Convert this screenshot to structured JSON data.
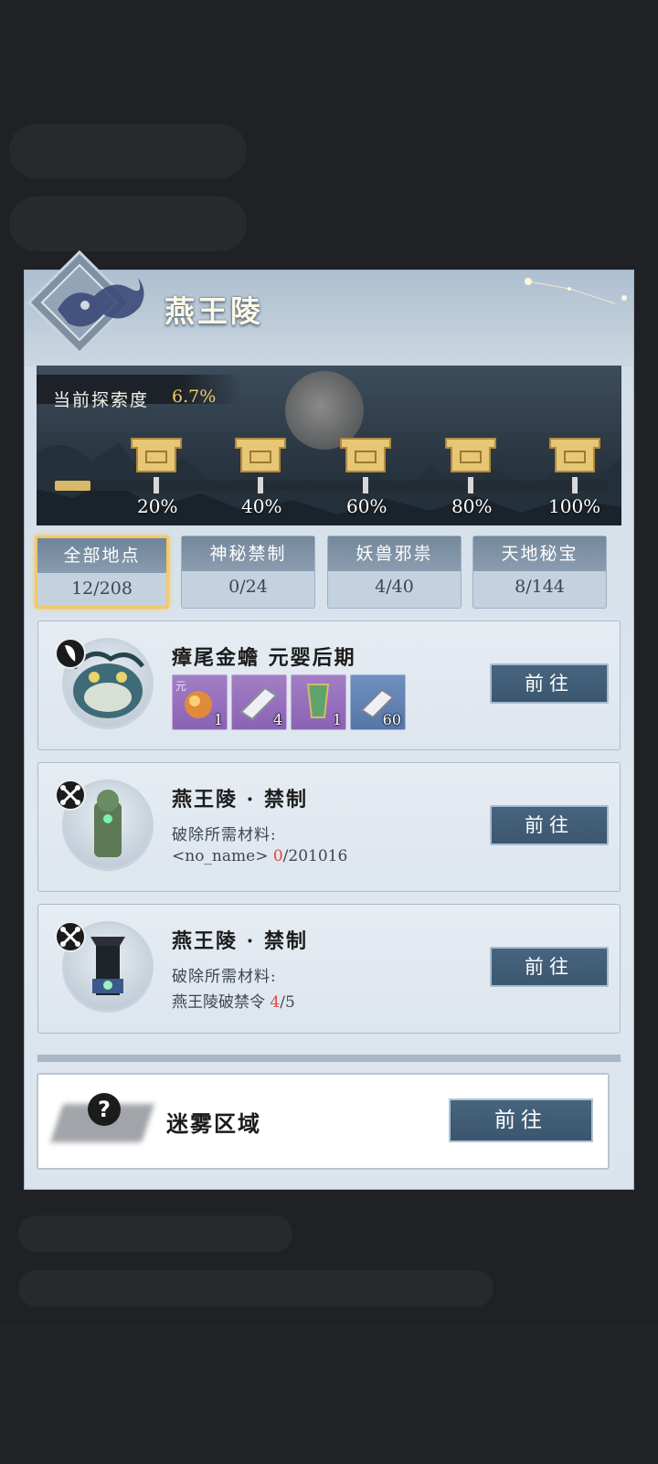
{
  "header": {
    "title": "燕王陵"
  },
  "progress": {
    "label": "当前探索度",
    "value": "6.7%",
    "fill_fraction": 0.067,
    "milestones": [
      "20%",
      "40%",
      "60%",
      "80%",
      "100%"
    ]
  },
  "tabs": [
    {
      "label": "全部地点",
      "count": "12/208",
      "active": true
    },
    {
      "label": "神秘禁制",
      "count": "0/24",
      "active": false
    },
    {
      "label": "妖兽邪祟",
      "count": "4/40",
      "active": false
    },
    {
      "label": "天地秘宝",
      "count": "8/144",
      "active": false
    }
  ],
  "cards": [
    {
      "title": "瘴尾金蟾 元婴后期",
      "items": [
        {
          "count": "1",
          "color": "purple",
          "tag": "元"
        },
        {
          "count": "4",
          "color": "purple"
        },
        {
          "count": "1",
          "color": "purple"
        },
        {
          "count": "60",
          "color": "blue"
        }
      ],
      "button": "前往"
    },
    {
      "title": "燕王陵 · 禁制",
      "subtitle": "破除所需材料:",
      "material_name": "<no_name> ",
      "material_have": "0",
      "material_need": "/201016",
      "button": "前往"
    },
    {
      "title": "燕王陵 · 禁制",
      "subtitle": "破除所需材料:",
      "material_name": "燕王陵破禁令 ",
      "material_have": "4",
      "material_need": "/5",
      "button": "前往"
    }
  ],
  "fog": {
    "title": "迷雾区域",
    "button": "前往",
    "icon": "?"
  },
  "colors": {
    "accent_gold": "#f2c86a",
    "button_blue": "#47647e",
    "highlight_red": "#e14a3d"
  }
}
